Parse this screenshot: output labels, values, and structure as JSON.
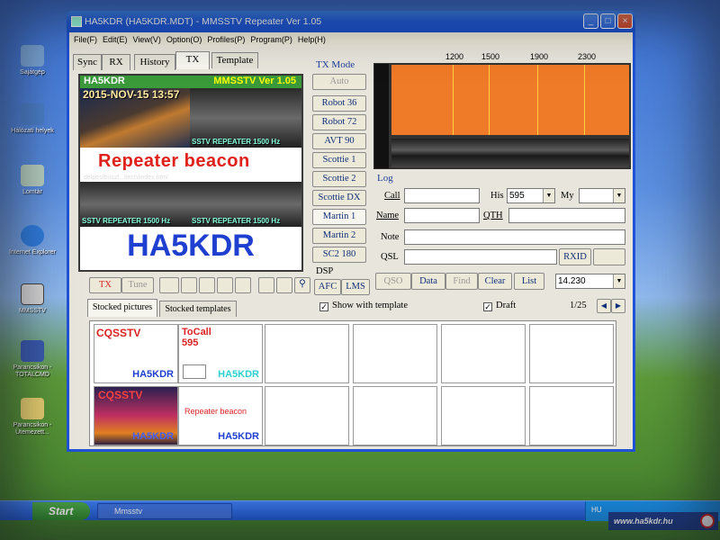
{
  "desktop": {
    "icons": [
      "Sajátgép",
      "Hálózati helyek",
      "Lomtár",
      "Internet Explorer",
      "MMSSTV",
      "Parancsikon - TOTALCMD",
      "Parancsikon - Ütemezett..."
    ]
  },
  "window": {
    "title": "HA5KDR (HA5KDR.MDT) - MMSSTV Repeater Ver 1.05",
    "min": "_",
    "max": "□",
    "close": "×"
  },
  "menu": [
    "File(F)",
    "Edit(E)",
    "View(V)",
    "Option(O)",
    "Profiles(P)",
    "Program(P)",
    "Help(H)"
  ],
  "tabs": [
    "Sync",
    "RX",
    "History",
    "TX",
    "Template"
  ],
  "preview": {
    "callsign_top": "HA5KDR",
    "version": "MMSSTV Ver 1.05",
    "date": "2015-NOV-15 13:57",
    "caption": "SSTV REPEATER 1500 Hz",
    "beacon": "Repeater beacon",
    "url": "delpestbuszt...tlech/index.html",
    "callsign_big": "HA5KDR"
  },
  "tx_toolbar": {
    "tx": "TX",
    "tune": "Tune"
  },
  "tx_mode": {
    "title": "TX Mode",
    "modes": [
      "Auto",
      "Robot 36",
      "Robot 72",
      "AVT 90",
      "Scottie 1",
      "Scottie 2",
      "Scottie DX",
      "Martin 1",
      "Martin 2",
      "SC2 180"
    ]
  },
  "dsp": {
    "title": "DSP",
    "afc": "AFC",
    "lms": "LMS"
  },
  "spectrum": {
    "scale": [
      "1200",
      "1500",
      "1900",
      "2300"
    ]
  },
  "log": {
    "title": "Log",
    "call_label": "Call",
    "his_label": "His",
    "his_value": "595",
    "my_label": "My",
    "my_value": "",
    "name_label": "Name",
    "qth_label": "QTH",
    "note_label": "Note",
    "qsl_label": "QSL",
    "rxid": "RXID",
    "qso": "QSO",
    "data": "Data",
    "find": "Find",
    "clear": "Clear",
    "list": "List",
    "freq": "14.230"
  },
  "stock": {
    "tab_pictures": "Stocked pictures",
    "tab_templates": "Stocked templates",
    "show_with_template": "Show with template",
    "draft": "Draft",
    "page": "1/25",
    "prev": "◀",
    "next": "▶",
    "thumb1_text": "CQSSTV",
    "thumb1_call": "HA5KDR",
    "thumb2_text": "ToCall",
    "thumb2_rst": "595",
    "thumb2_call": "HA5KDR",
    "thumb3_text": "CQSSTV",
    "thumb3_call": "HA5KDR",
    "thumb4_text": "Repeater beacon",
    "thumb4_call": "HA5KDR"
  },
  "taskbar": {
    "start": "Start",
    "task": "Mmsstv",
    "lang": "HU"
  },
  "watermark": "www.ha5kdr.hu"
}
